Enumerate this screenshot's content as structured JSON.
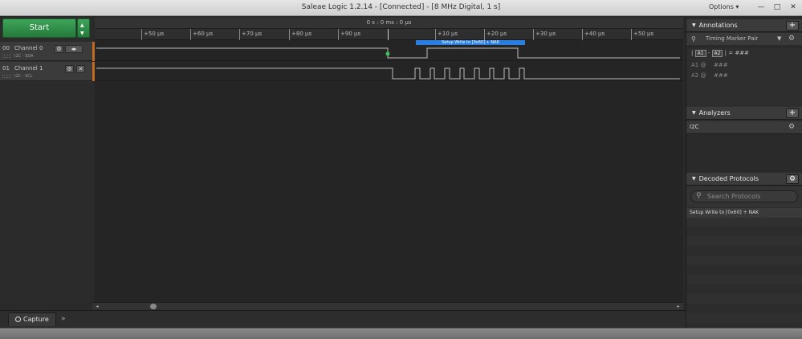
{
  "window": {
    "title": "Saleae Logic 1.2.14 - [Connected] - [8 MHz Digital, 1 s]",
    "options_label": "Options ▾",
    "controls": [
      "—",
      "□",
      "✕"
    ]
  },
  "capture": {
    "start_label": "Start"
  },
  "channels": [
    {
      "num": "00",
      "name": "Channel 0",
      "sub": "I2C - SDA"
    },
    {
      "num": "01",
      "name": "Channel 1",
      "sub": "I2C - SCL"
    }
  ],
  "timeline": {
    "header": "0 s : 0 ms : 0 μs",
    "ticks": [
      "+50 μs",
      "+60 μs",
      "+70 μs",
      "+80 μs",
      "+90 μs",
      "+10 μs",
      "+20 μs",
      "+30 μs",
      "+40 μs",
      "+50 μs"
    ],
    "protocol_bubble": "Setup Write to [0x60] + NAK"
  },
  "bottom": {
    "capture_tab": "Capture",
    "more_glyph": "»"
  },
  "annotations": {
    "title": "Annotations",
    "add_glyph": "+",
    "marker_pair": "Timing Marker Pair",
    "a1": "A1",
    "a2": "A2",
    "diff_value": "= ###",
    "a1_label": "A1  @",
    "a1_value": "###",
    "a2_label": "A2  @",
    "a2_value": "###"
  },
  "analyzers": {
    "title": "Analyzers",
    "add_glyph": "+",
    "items": [
      "I2C"
    ]
  },
  "decoded": {
    "title": "Decoded Protocols",
    "search_placeholder": "Search Protocols",
    "rows": [
      "Setup Write to [0x60] + NAK"
    ]
  },
  "icons": {
    "gear": "gear-icon",
    "search": "search-icon",
    "pin": "pin-icon"
  }
}
